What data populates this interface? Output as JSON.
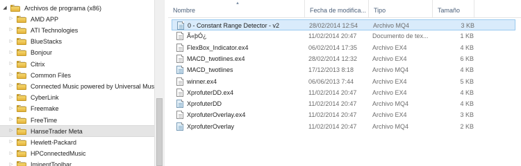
{
  "nav": {
    "items": [
      {
        "label": "Archivos de programa (x86)",
        "expanded": true,
        "selected": false,
        "indent": 0
      },
      {
        "label": "AMD APP",
        "expanded": false,
        "selected": false,
        "indent": 1
      },
      {
        "label": "ATI Technologies",
        "expanded": false,
        "selected": false,
        "indent": 1
      },
      {
        "label": "BlueStacks",
        "expanded": false,
        "selected": false,
        "indent": 1
      },
      {
        "label": "Bonjour",
        "expanded": false,
        "selected": false,
        "indent": 1
      },
      {
        "label": "Citrix",
        "expanded": false,
        "selected": false,
        "indent": 1
      },
      {
        "label": "Common Files",
        "expanded": false,
        "selected": false,
        "indent": 1
      },
      {
        "label": "Connected Music powered by Universal Music",
        "expanded": false,
        "selected": false,
        "indent": 1
      },
      {
        "label": "CyberLink",
        "expanded": false,
        "selected": false,
        "indent": 1
      },
      {
        "label": "Freemake",
        "expanded": false,
        "selected": false,
        "indent": 1
      },
      {
        "label": "FreeTime",
        "expanded": false,
        "selected": false,
        "indent": 1
      },
      {
        "label": "HanseTrader Meta",
        "expanded": false,
        "selected": true,
        "indent": 1
      },
      {
        "label": "Hewlett-Packard",
        "expanded": false,
        "selected": false,
        "indent": 1
      },
      {
        "label": "HPConnectedMusic",
        "expanded": false,
        "selected": false,
        "indent": 1
      },
      {
        "label": "IminentToolbar",
        "expanded": false,
        "selected": false,
        "indent": 1
      }
    ]
  },
  "columns": {
    "name": "Nombre",
    "date": "Fecha de modifica...",
    "type": "Tipo",
    "size": "Tamaño"
  },
  "files": [
    {
      "name": "0 - Constant Range Detector - v2",
      "date": "28/02/2014 12:54",
      "type": "Archivo MQ4",
      "size": "3 KB",
      "icon": "mq4-file-icon",
      "selected": true
    },
    {
      "name": "Ã«þÓ¿",
      "date": "11/02/2014 20:47",
      "type": "Documento de tex...",
      "size": "1 KB",
      "icon": "text-file-icon",
      "selected": false
    },
    {
      "name": "FlexBox_Indicator.ex4",
      "date": "06/02/2014 17:35",
      "type": "Archivo EX4",
      "size": "4 KB",
      "icon": "ex4-file-icon",
      "selected": false
    },
    {
      "name": "MACD_twotlines.ex4",
      "date": "28/02/2014 12:32",
      "type": "Archivo EX4",
      "size": "6 KB",
      "icon": "ex4-file-icon",
      "selected": false
    },
    {
      "name": "MACD_twotlines",
      "date": "17/12/2013 8:18",
      "type": "Archivo MQ4",
      "size": "4 KB",
      "icon": "mq4-file-icon",
      "selected": false
    },
    {
      "name": "winner.ex4",
      "date": "06/06/2013 7:44",
      "type": "Archivo EX4",
      "size": "5 KB",
      "icon": "ex4-file-icon",
      "selected": false
    },
    {
      "name": "XprofuterDD.ex4",
      "date": "11/02/2014 20:47",
      "type": "Archivo EX4",
      "size": "4 KB",
      "icon": "ex4-file-icon",
      "selected": false
    },
    {
      "name": "XprofuterDD",
      "date": "11/02/2014 20:47",
      "type": "Archivo MQ4",
      "size": "4 KB",
      "icon": "mq4-file-icon",
      "selected": false
    },
    {
      "name": "XprofuterOverlay.ex4",
      "date": "11/02/2014 20:47",
      "type": "Archivo EX4",
      "size": "3 KB",
      "icon": "ex4-file-icon",
      "selected": false
    },
    {
      "name": "XprofuterOverlay",
      "date": "11/02/2014 20:47",
      "type": "Archivo MQ4",
      "size": "2 KB",
      "icon": "mq4-file-icon",
      "selected": false
    }
  ]
}
